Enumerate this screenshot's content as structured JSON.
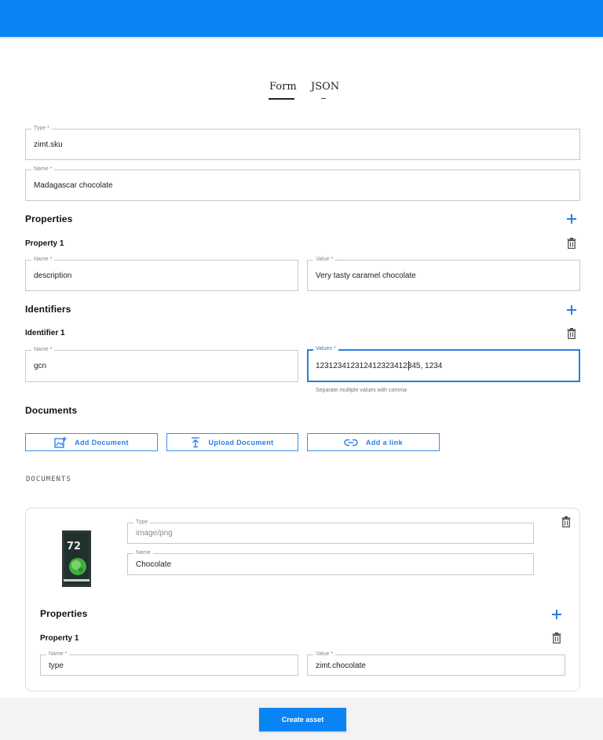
{
  "tabs": {
    "form": "Form",
    "json": "JSON"
  },
  "asset": {
    "type_label": "Type *",
    "type_value": "zimt.sku",
    "name_label": "Name *",
    "name_value": "Madagascar chocolate"
  },
  "properties": {
    "title": "Properties",
    "items": [
      {
        "title": "Property 1",
        "name_label": "Name *",
        "name_value": "description",
        "value_label": "Value *",
        "value_value": "Very tasty caramel chocolate"
      }
    ]
  },
  "identifiers": {
    "title": "Identifiers",
    "items": [
      {
        "title": "Identifier 1",
        "name_label": "Name *",
        "name_value": "gcn",
        "values_label": "Values *",
        "values_value": "123123412312412323412345, 1234",
        "hint": "Separate multiple values with comma"
      }
    ]
  },
  "documents": {
    "title": "Documents",
    "add_document": "Add Document",
    "upload_document": "Upload Document",
    "add_link": "Add a link",
    "caption": "DOCUMENTS",
    "items": [
      {
        "type_label": "Type",
        "type_value": "image/png",
        "name_label": "Name",
        "name_value": "Chocolate",
        "properties_title": "Properties",
        "properties": [
          {
            "title": "Property 1",
            "name_label": "Name *",
            "name_value": "type",
            "value_label": "Value *",
            "value_value": "zimt.chocolate"
          }
        ]
      }
    ]
  },
  "footer": {
    "create_button": "Create asset"
  },
  "colors": {
    "primary": "#0a84f5",
    "accent": "#2a7de1"
  },
  "icons": [
    "plus-icon",
    "trash-icon",
    "add-photo-icon",
    "upload-icon",
    "link-icon"
  ]
}
